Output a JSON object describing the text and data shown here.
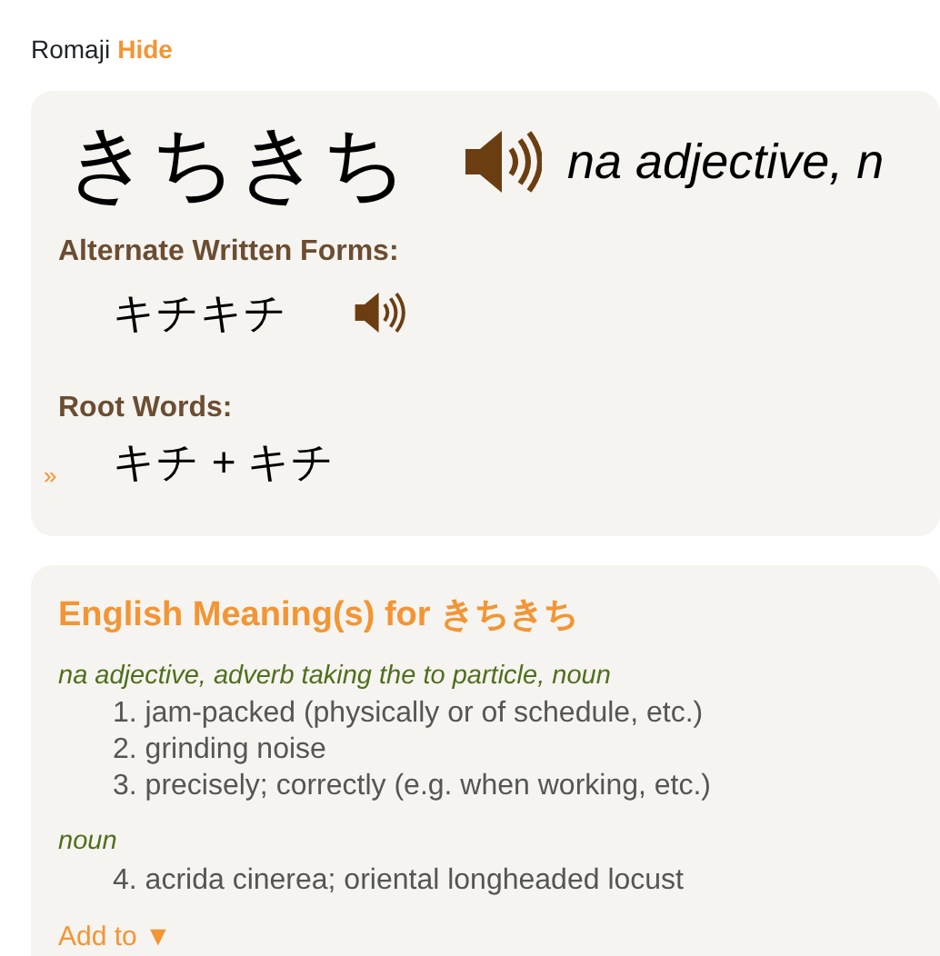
{
  "romaji": {
    "label": "Romaji",
    "toggle": "Hide"
  },
  "entry": {
    "word": "きちきち",
    "pos": "na adjective, n",
    "alternate": {
      "label": "Alternate Written Forms:",
      "forms": [
        "キチキチ"
      ]
    },
    "root": {
      "label": "Root Words:",
      "marker": "»",
      "words": "キチ + キチ"
    }
  },
  "meanings": {
    "title": "English Meaning(s) for ",
    "word": "きちきち",
    "groups": [
      {
        "pos": "na adjective, adverb taking the to particle, noun",
        "senses": [
          {
            "number": "1.",
            "text": "jam-packed (physically or of schedule, etc.)"
          },
          {
            "number": "2.",
            "text": "grinding noise"
          },
          {
            "number": "3.",
            "text": "precisely; correctly (e.g. when working, etc.)"
          }
        ]
      },
      {
        "pos": "noun",
        "senses": [
          {
            "number": "4.",
            "text": "acrida cinerea; oriental longheaded locust"
          }
        ]
      }
    ],
    "add_to": "Add to ▼"
  }
}
